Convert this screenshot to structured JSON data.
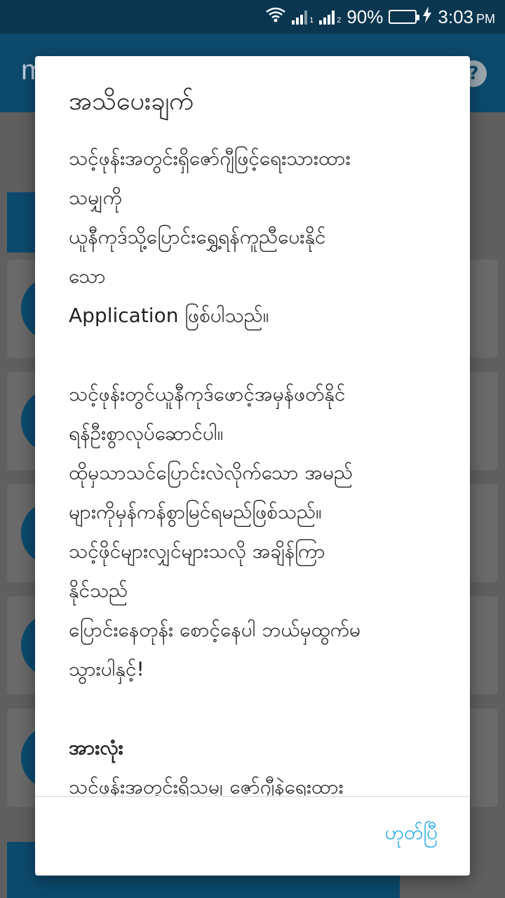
{
  "status_bar": {
    "battery": "90%",
    "time": "3:03",
    "ampm": "PM",
    "sim1": "1",
    "sim2": "2",
    "battery_level": 0.9
  },
  "background_app": {
    "title_fragment": "m"
  },
  "dialog": {
    "title": "အသိပေးချက်",
    "paragraph1": "သင့်ဖုန်းအတွင်းရှိဇော်ဂျီဖြင့်ရေးသားထား\nသမျှကို\nယူနီကုဒ်သို့ပြောင်းရွှေ့ရန်ကူညီပေးနိုင်\nသော\nApplication ဖြစ်ပါသည်။",
    "paragraph2": "သင့်ဖုန်းတွင်ယူနီကုဒ်ဖောင့်အမှန်ဖတ်နိုင်\nရန်ဦးစွာလုပ်ဆောင်ပါ။\nထိုမှသာသင်ပြောင်းလဲလိုက်သော အမည်\nများကိုမှန်ကန်စွာမြင်ရမည်ဖြစ်သည်။\nသင့်ဖိုင်များလျှင်များသလို အချိန်ကြာ\nနိုင်သည်\nပြောင်းနေတုန်း စောင့်နေပါ ဘယ်မှထွက်မ\nသွားပါနှင့်!",
    "section_heading": "အားလုံး",
    "paragraph3": "သင့်ဖုန်းအတွင်းရှိသမျှ ဇော်ဂျီနဲ့ရေးထား",
    "ok_label": "ဟုတ်ပြီ"
  },
  "colors": {
    "accent": "#1aa7e6",
    "app_bar": "#0c4a6d",
    "status_bar": "#0a3650"
  }
}
